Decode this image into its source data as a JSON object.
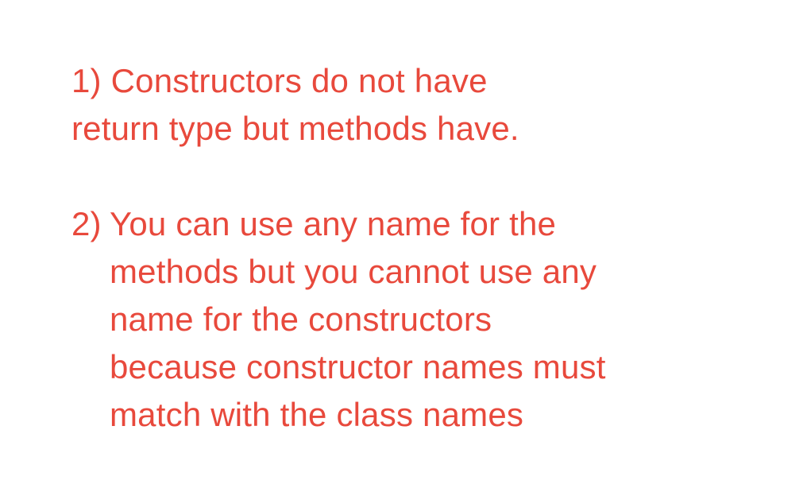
{
  "points": [
    {
      "lines": [
        "1) Constructors do not have",
        "return type but methods have."
      ]
    },
    {
      "number": "2)",
      "lines": [
        "You can use any name for the",
        "methods but you cannot use any",
        "name for the constructors",
        "because constructor names must",
        "match with the class names"
      ]
    }
  ],
  "colors": {
    "text": "#e8493c",
    "background": "#ffffff"
  }
}
